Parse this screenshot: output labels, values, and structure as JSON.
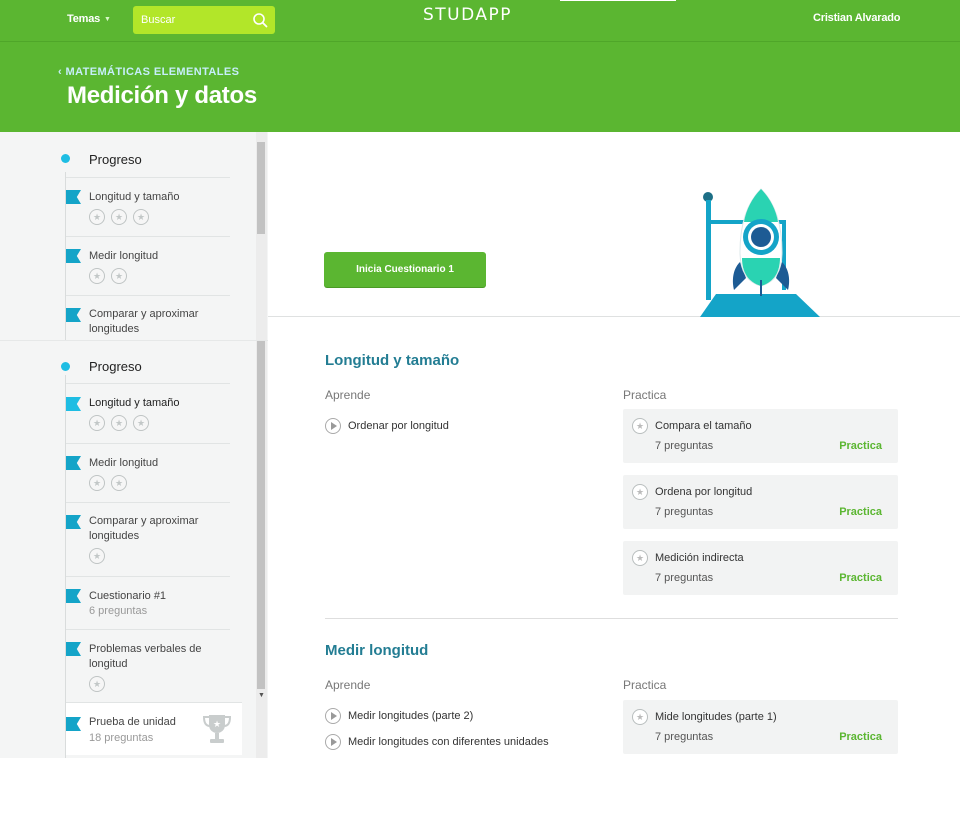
{
  "topbar": {
    "temas_label": "Temas",
    "search_placeholder": "Buscar",
    "brand": "STUDAPP",
    "user_name": "Cristian Alvarado"
  },
  "header": {
    "breadcrumb": "MATEMÁTICAS ELEMENTALES",
    "title": "Medición y datos"
  },
  "sidebar_top": {
    "heading": "Progreso",
    "items": [
      {
        "label": "Longitud y tamaño",
        "stars": 3
      },
      {
        "label": "Medir longitud",
        "stars": 2
      },
      {
        "label": "Comparar y aproximar longitudes",
        "stars": 0
      }
    ]
  },
  "sidebar": {
    "heading": "Progreso",
    "items": [
      {
        "label": "Longitud y tamaño",
        "stars": 3
      },
      {
        "label": "Medir longitud",
        "stars": 2
      },
      {
        "label": "Comparar y aproximar longitudes",
        "stars": 1
      },
      {
        "label": "Cuestionario #1",
        "sub": "6 preguntas"
      },
      {
        "label": "Problemas verbales de longitud",
        "stars": 1
      }
    ],
    "unit_test": {
      "label": "Prueba de unidad",
      "sub": "18 preguntas"
    }
  },
  "hero": {
    "quiz_button": "Inicia Cuestionario 1"
  },
  "sections": [
    {
      "title": "Longitud y tamaño",
      "learn_heading": "Aprende",
      "practice_heading": "Practica",
      "learn": [
        "Ordenar por longitud"
      ],
      "practice": [
        {
          "title": "Compara el tamaño",
          "sub": "7 preguntas",
          "action": "Practica"
        },
        {
          "title": "Ordena por longitud",
          "sub": "7 preguntas",
          "action": "Practica"
        },
        {
          "title": "Medición indirecta",
          "sub": "7 preguntas",
          "action": "Practica"
        }
      ]
    },
    {
      "title": "Medir longitud",
      "learn_heading": "Aprende",
      "practice_heading": "Practica",
      "learn": [
        "Medir longitudes (parte 2)",
        "Medir longitudes con diferentes unidades"
      ],
      "practice": [
        {
          "title": "Mide longitudes (parte 1)",
          "sub": "7 preguntas",
          "action": "Practica"
        }
      ]
    }
  ],
  "colors": {
    "brand_green": "#5bb631",
    "search_lime": "#b2e629",
    "accent_teal": "#237d93",
    "flag_blue": "#14a4c8",
    "progress_dot": "#1ebde3"
  }
}
